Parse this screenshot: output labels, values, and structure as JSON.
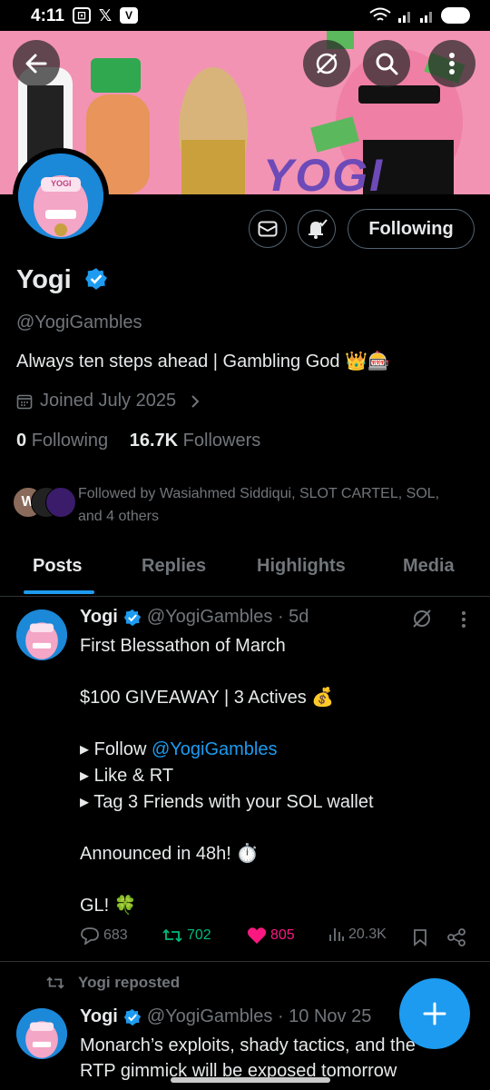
{
  "status_bar": {
    "time": "4:11"
  },
  "header": {
    "banner_text": "YOGI",
    "banner_bg": "#f293b4"
  },
  "profile": {
    "name": "Yogi",
    "handle": "@YogiGambles",
    "bio": "Always ten steps ahead | Gambling God 👑🎰",
    "joined": "Joined July 2025",
    "following_count": "0",
    "following_label": "Following",
    "followers_count": "16.7K",
    "followers_label": "Followers",
    "followed_by": "Followed by Wasiahmed Siddiqui, SLOT CARTEL, SOL, and 4 others",
    "following_button": "Following",
    "avatar_label": "YOGI"
  },
  "tabs": [
    "Posts",
    "Replies",
    "Highlights",
    "Media"
  ],
  "post1": {
    "name": "Yogi",
    "handle_time": "@YogiGambles · 5d",
    "lines": {
      "l1": "First Blessathon of March",
      "l2": "$100 GIVEAWAY | 3 Actives 💰",
      "l3a": "▸ Follow ",
      "l3b": "@YogiGambles",
      "l4": "▸ Like & RT",
      "l5": "▸ Tag 3 Friends with your SOL wallet",
      "l6": "Announced in 48h! ⏱️",
      "l7": "GL! 🍀"
    },
    "replies": "683",
    "reposts": "702",
    "likes": "805",
    "views": "20.3K"
  },
  "post2": {
    "repost_label": "Yogi reposted",
    "name": "Yogi",
    "handle_time": "@YogiGambles · 10 Nov 25",
    "text": "Monarch’s exploits, shady tactics, and the",
    "text2": "RTP gimmick will be exposed tomorrow"
  },
  "colors": {
    "accent": "#1d9bf0",
    "like": "#f91880",
    "repost": "#00ba7c",
    "muted": "#71767b"
  }
}
